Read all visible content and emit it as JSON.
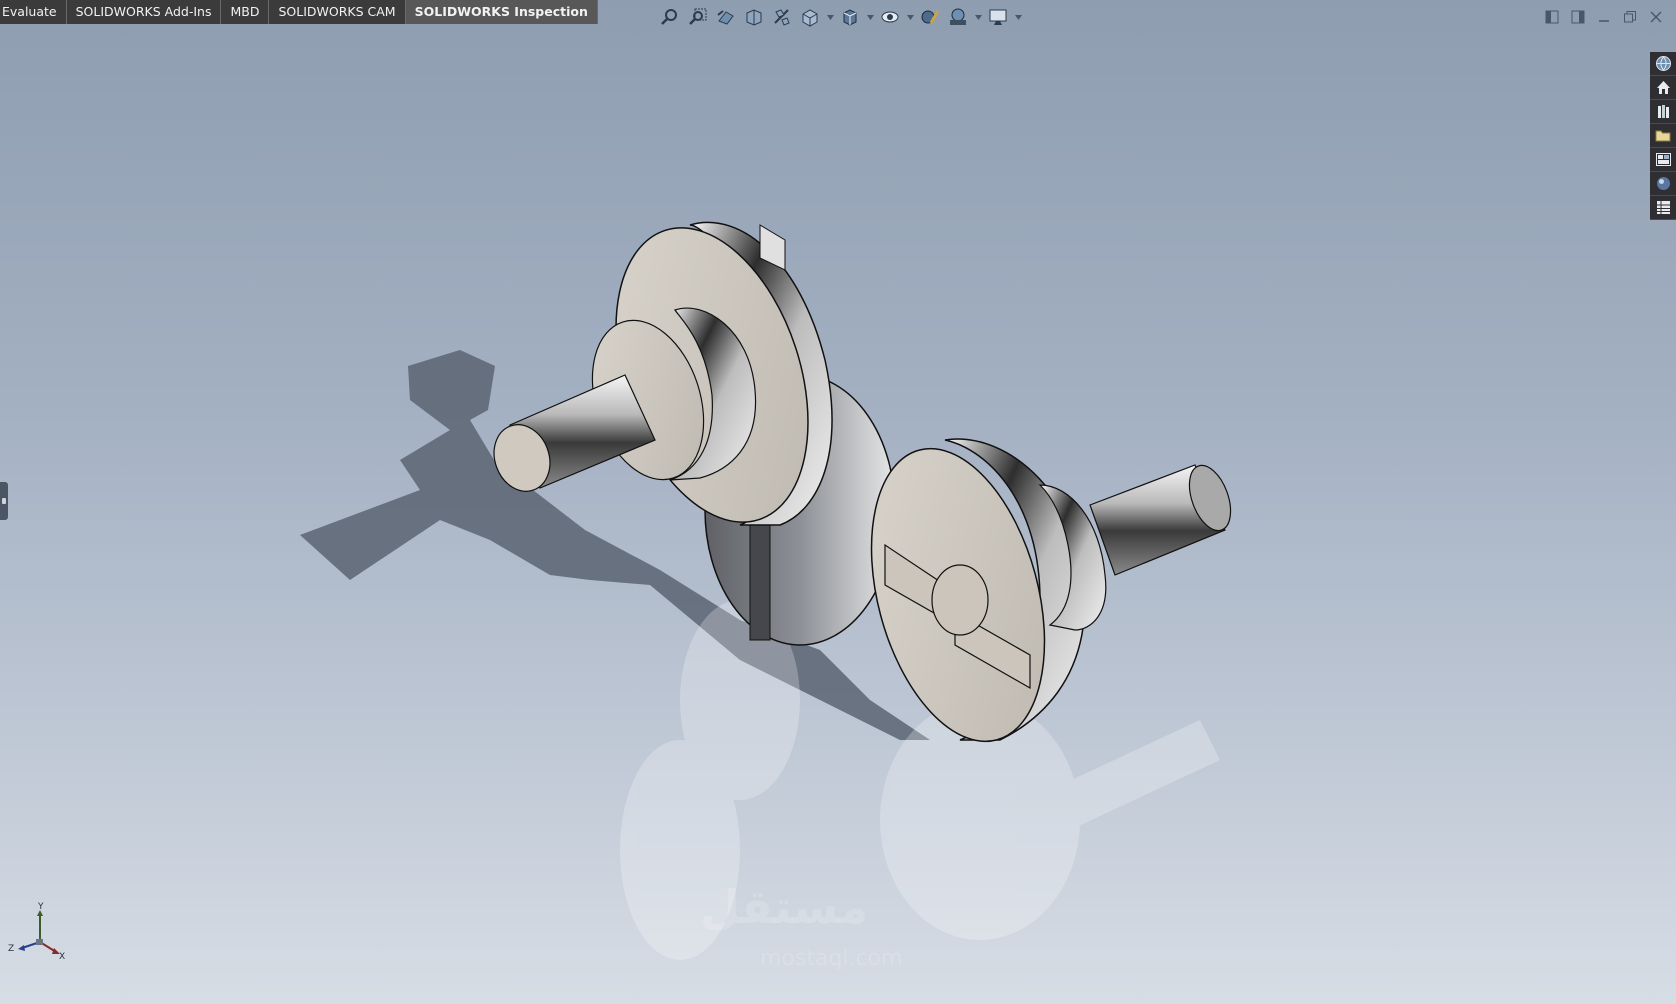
{
  "command_manager": {
    "tabs": [
      {
        "label": "Evaluate",
        "active": false
      },
      {
        "label": "SOLIDWORKS Add-Ins",
        "active": false
      },
      {
        "label": "MBD",
        "active": false
      },
      {
        "label": "SOLIDWORKS CAM",
        "active": false
      },
      {
        "label": "SOLIDWORKS Inspection",
        "active": true
      }
    ]
  },
  "heads_up_toolbar": {
    "buttons": [
      "zoom-to-fit-icon",
      "zoom-to-area-icon",
      "previous-view-icon",
      "section-view-icon",
      "dynamic-annotation-views-icon",
      "view-orientation-icon",
      "display-style-icon",
      "hide-show-items-icon",
      "edit-appearance-icon",
      "apply-scene-icon",
      "view-settings-icon"
    ]
  },
  "window_controls": [
    "tile-left-icon",
    "tile-right-icon",
    "minimize-icon",
    "restore-icon",
    "close-icon"
  ],
  "task_pane": {
    "buttons": [
      "solidworks-resources-icon",
      "home-icon",
      "design-library-icon",
      "file-explorer-icon",
      "view-palette-icon",
      "appearances-scenes-icon",
      "custom-properties-icon"
    ]
  },
  "triad": {
    "x": "X",
    "y": "Y",
    "z": "Z"
  },
  "watermark": {
    "text": "مستقل",
    "sub": "mostaql.com"
  },
  "colors": {
    "tab_bg": "#3b3b3b",
    "tab_active_bg": "#585858",
    "viewport_top": "#8f9db1",
    "viewport_bottom": "#d7dde5"
  }
}
